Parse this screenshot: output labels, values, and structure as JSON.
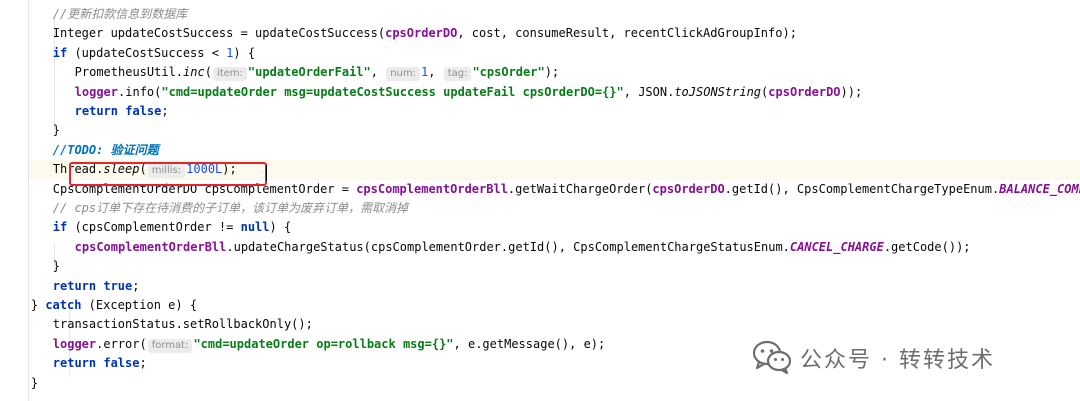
{
  "editor": {
    "lines": [
      {
        "indent": 4,
        "tokens": [
          {
            "cls": "cmt",
            "text": "//更新扣款信息到数据库"
          }
        ]
      },
      {
        "indent": 4,
        "tokens": [
          {
            "cls": "",
            "text": "Integer updateCostSuccess = updateCostSuccess("
          },
          {
            "cls": "field",
            "text": "cpsOrderDO"
          },
          {
            "cls": "",
            "text": ", cost, consumeResult, recentClickAdGroupInfo);"
          }
        ]
      },
      {
        "indent": 4,
        "tokens": [
          {
            "cls": "kw",
            "text": "if"
          },
          {
            "cls": "",
            "text": " (updateCostSuccess < "
          },
          {
            "cls": "num",
            "text": "1"
          },
          {
            "cls": "",
            "text": ") {"
          }
        ]
      },
      {
        "indent": 6,
        "tokens": [
          {
            "cls": "",
            "text": "PrometheusUtil."
          },
          {
            "cls": "static-m",
            "text": "inc"
          },
          {
            "cls": "",
            "text": "("
          },
          {
            "cls": "hint",
            "text": "item:"
          },
          {
            "cls": "str",
            "text": "\"updateOrderFail\""
          },
          {
            "cls": "",
            "text": ", "
          },
          {
            "cls": "hint",
            "text": "num:"
          },
          {
            "cls": "num",
            "text": "1"
          },
          {
            "cls": "",
            "text": ", "
          },
          {
            "cls": "hint",
            "text": "tag:"
          },
          {
            "cls": "str",
            "text": "\"cpsOrder\""
          },
          {
            "cls": "",
            "text": ");"
          }
        ]
      },
      {
        "indent": 6,
        "tokens": [
          {
            "cls": "field",
            "text": "logger"
          },
          {
            "cls": "",
            "text": ".info("
          },
          {
            "cls": "str",
            "text": "\"cmd=updateOrder msg=updateCostSuccess updateFail cpsOrderDO={}\""
          },
          {
            "cls": "",
            "text": ", JSON."
          },
          {
            "cls": "static-m",
            "text": "toJSONString"
          },
          {
            "cls": "",
            "text": "("
          },
          {
            "cls": "field",
            "text": "cpsOrderDO"
          },
          {
            "cls": "",
            "text": "));"
          }
        ]
      },
      {
        "indent": 6,
        "tokens": [
          {
            "cls": "kw",
            "text": "return"
          },
          {
            "cls": "",
            "text": " "
          },
          {
            "cls": "kw",
            "text": "false"
          },
          {
            "cls": "",
            "text": ";"
          }
        ]
      },
      {
        "indent": 4,
        "tokens": [
          {
            "cls": "",
            "text": "}"
          }
        ]
      },
      {
        "indent": 4,
        "tokens": [
          {
            "cls": "todo",
            "text": "//TODO: 验证问题"
          }
        ]
      },
      {
        "indent": 4,
        "current": true,
        "tokens": [
          {
            "cls": "",
            "text": "Thread."
          },
          {
            "cls": "static-m",
            "text": "sleep"
          },
          {
            "cls": "",
            "text": "("
          },
          {
            "cls": "hint",
            "text": "millis:"
          },
          {
            "cls": "num",
            "text": "1000L"
          },
          {
            "cls": "",
            "text": ");"
          }
        ]
      },
      {
        "indent": 4,
        "tokens": [
          {
            "cls": "",
            "text": "CpsComplementOrderDO cpsComplementOrder = "
          },
          {
            "cls": "field",
            "text": "cpsComplementOrderBll"
          },
          {
            "cls": "",
            "text": ".getWaitChargeOrder("
          },
          {
            "cls": "field",
            "text": "cpsOrderDO"
          },
          {
            "cls": "",
            "text": ".getId(), CpsComplementChargeTypeEnum."
          },
          {
            "cls": "enum-c",
            "text": "BALANCE_COMPLEMENT"
          },
          {
            "cls": "",
            "text": ");"
          }
        ]
      },
      {
        "indent": 4,
        "tokens": [
          {
            "cls": "cmt",
            "text": "// cps订单下存在待消费的子订单，该订单为废弃订单，需取消掉"
          }
        ]
      },
      {
        "indent": 4,
        "tokens": [
          {
            "cls": "kw",
            "text": "if"
          },
          {
            "cls": "",
            "text": " (cpsComplementOrder != "
          },
          {
            "cls": "kw",
            "text": "null"
          },
          {
            "cls": "",
            "text": ") {"
          }
        ]
      },
      {
        "indent": 6,
        "tokens": [
          {
            "cls": "field",
            "text": "cpsComplementOrderBll"
          },
          {
            "cls": "",
            "text": ".updateChargeStatus(cpsComplementOrder.getId(), CpsComplementChargeStatusEnum."
          },
          {
            "cls": "enum-c",
            "text": "CANCEL_CHARGE"
          },
          {
            "cls": "",
            "text": ".getCode());"
          }
        ]
      },
      {
        "indent": 4,
        "tokens": [
          {
            "cls": "",
            "text": "}"
          }
        ]
      },
      {
        "indent": 4,
        "tokens": [
          {
            "cls": "kw",
            "text": "return"
          },
          {
            "cls": "",
            "text": " "
          },
          {
            "cls": "kw",
            "text": "true"
          },
          {
            "cls": "",
            "text": ";"
          }
        ]
      },
      {
        "indent": 2,
        "tokens": [
          {
            "cls": "",
            "text": "} "
          },
          {
            "cls": "kw",
            "text": "catch"
          },
          {
            "cls": "",
            "text": " (Exception e) {"
          }
        ]
      },
      {
        "indent": 4,
        "tokens": [
          {
            "cls": "",
            "text": "transactionStatus.setRollbackOnly();"
          }
        ]
      },
      {
        "indent": 4,
        "tokens": [
          {
            "cls": "field",
            "text": "logger"
          },
          {
            "cls": "",
            "text": ".error("
          },
          {
            "cls": "hint",
            "text": "format:"
          },
          {
            "cls": "str",
            "text": "\"cmd=updateOrder op=rollback msg={}\""
          },
          {
            "cls": "",
            "text": ", e.getMessage(), e);"
          }
        ]
      },
      {
        "indent": 4,
        "tokens": [
          {
            "cls": "kw",
            "text": "return"
          },
          {
            "cls": "",
            "text": " "
          },
          {
            "cls": "kw",
            "text": "false"
          },
          {
            "cls": "",
            "text": ";"
          }
        ]
      },
      {
        "indent": 2,
        "tokens": [
          {
            "cls": "",
            "text": "}"
          }
        ]
      }
    ]
  },
  "watermark": {
    "text": "公众号 · 转转技术",
    "icon": "wechat-icon",
    "color": "#6e6e6e"
  },
  "highlight": {
    "color": "#e8232b",
    "line_index": 8
  }
}
